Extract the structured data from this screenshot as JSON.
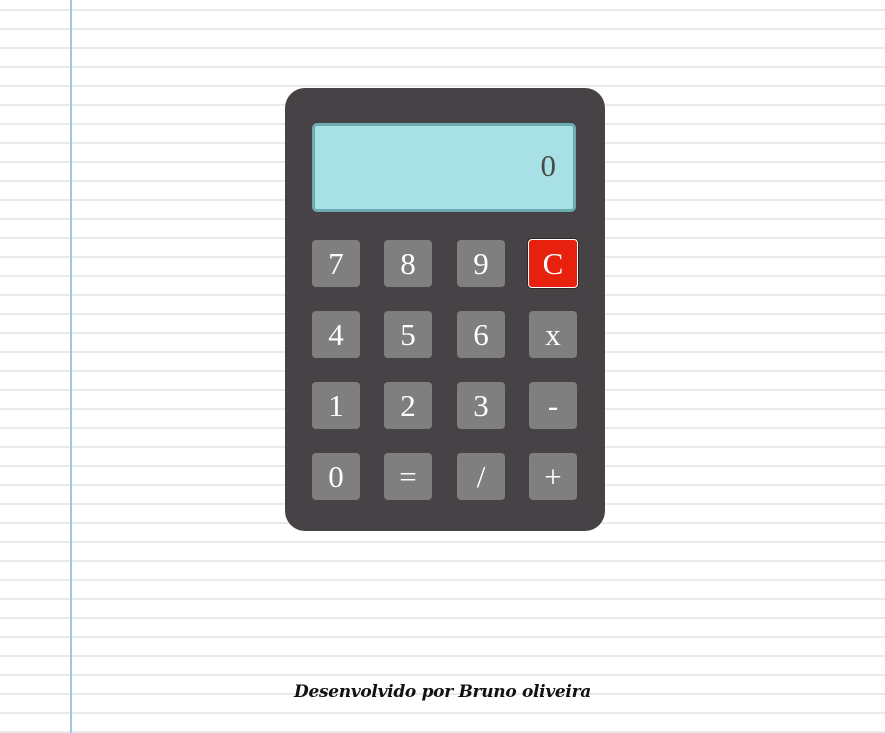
{
  "calculator": {
    "display_value": "0",
    "keys": [
      "7",
      "8",
      "9",
      "C",
      "4",
      "5",
      "6",
      "x",
      "1",
      "2",
      "3",
      "-",
      "0",
      "=",
      "/",
      "+"
    ]
  },
  "footer": {
    "text": "Desenvolvido por Bruno oliveira"
  },
  "colors": {
    "body_case": "#474246",
    "display_bg": "#a8e1e5",
    "display_border": "#6dabb2",
    "key_bg": "#7f7f7f",
    "clear_key_bg": "#e8200e",
    "margin_line": "#9fc9dd"
  }
}
